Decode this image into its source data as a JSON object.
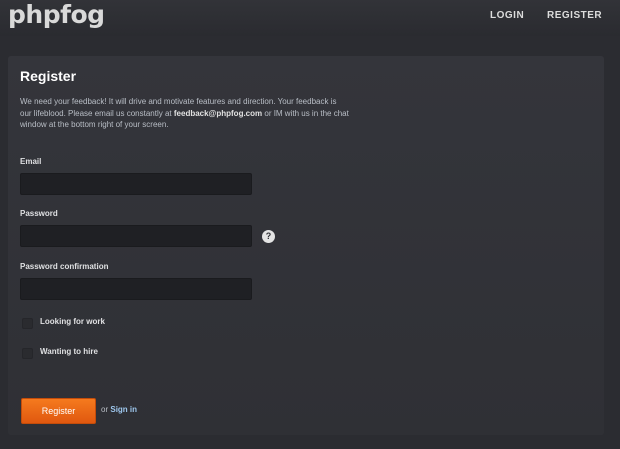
{
  "header": {
    "logo_text": "phpfog",
    "nav": {
      "login": "LOGIN",
      "register": "REGISTER"
    }
  },
  "form": {
    "title": "Register",
    "intro": {
      "part1": "We need your feedback! It will drive and motivate features and direction. Your feedback is our lifeblood. Please email us constantly at ",
      "email": "feedback@phpfog.com",
      "part2": " or IM with us in the chat window at the bottom right of your screen."
    },
    "email_label": "Email",
    "email_value": "",
    "password_label": "Password",
    "password_value": "",
    "password_help_icon": "help-icon",
    "password_help_text": "?",
    "password_confirmation_label": "Password confirmation",
    "password_confirmation_value": "",
    "looking_for_work_label": "Looking for work",
    "looking_for_work_checked": false,
    "wanting_to_hire_label": "Wanting to hire",
    "wanting_to_hire_checked": false,
    "submit_label": "Register",
    "or_text": "or",
    "signin_link": "Sign in"
  },
  "colors": {
    "background": "#2b2c31",
    "accent": "#f26e1a",
    "link": "#9ec7ee"
  }
}
